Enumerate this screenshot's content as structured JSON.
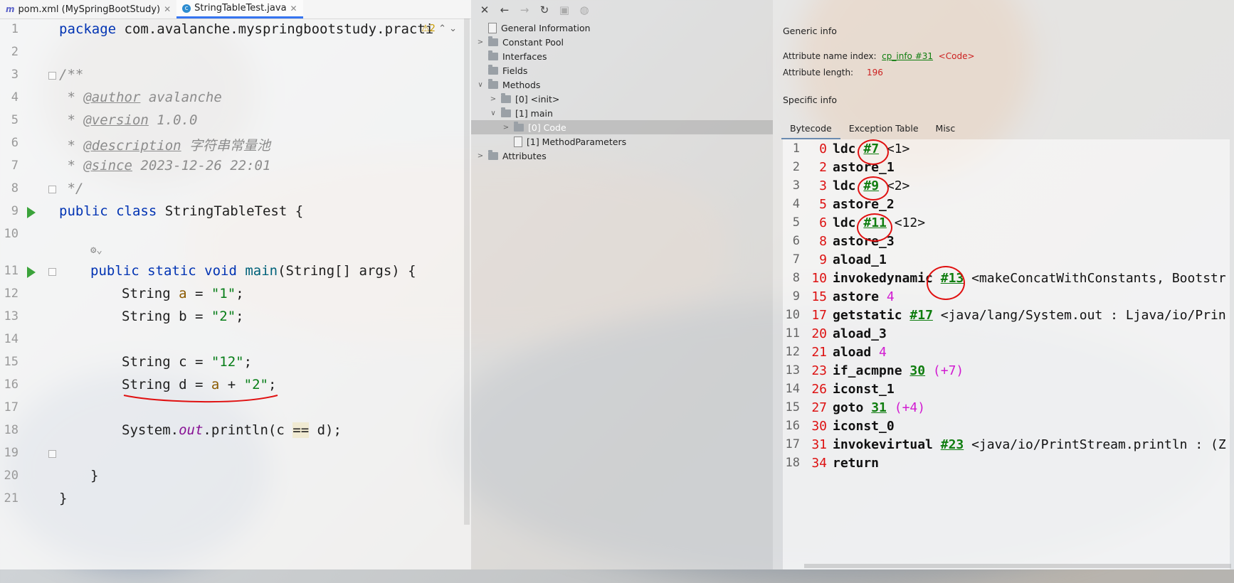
{
  "tabs": [
    {
      "icon": "m",
      "label": "pom.xml (MySpringBootStudy)"
    },
    {
      "icon": "c",
      "label": "StringTableTest.java"
    }
  ],
  "editor": {
    "line_numbers": [
      "1",
      "2",
      "3",
      "4",
      "5",
      "6",
      "7",
      "8",
      "9",
      "10",
      "11",
      "12",
      "13",
      "14",
      "15",
      "16",
      "17",
      "18",
      "19",
      "20",
      "21"
    ],
    "warning_count": "2",
    "code": {
      "l1_kw": "package",
      "l1_rest": " com.avalanche.myspringbootstudy.practi",
      "l3": "/**",
      "l4_pre": " * ",
      "l4_tag": "@author",
      "l4_val": " avalanche",
      "l5_pre": " * ",
      "l5_tag": "@version",
      "l5_val": " 1.0.0",
      "l6_pre": " * ",
      "l6_tag": "@description",
      "l6_val": " 字符串常量池",
      "l7_pre": " * ",
      "l7_tag": "@since",
      "l7_val": " 2023-12-26 22:01",
      "l8": " */",
      "l9_kw": "public class",
      "l9_rest": " StringTableTest {",
      "l11_kw": "public static void",
      "l11_fn": " main",
      "l11_rest": "(String[] args) {",
      "l12_a": "String ",
      "l12_v": "a",
      "l12_b": " = ",
      "l12_s": "\"1\"",
      "l12_c": ";",
      "l13_a": "String b = ",
      "l13_s": "\"2\"",
      "l13_c": ";",
      "l15_a": "String c = ",
      "l15_s": "\"12\"",
      "l15_c": ";",
      "l16_a": "String d = ",
      "l16_v": "a",
      "l16_b": " + ",
      "l16_s": "\"2\"",
      "l16_c": ";",
      "l18_a": "System.",
      "l18_f": "out",
      "l18_b": ".println(c ",
      "l18_op": "==",
      "l18_c": " d);",
      "l19": "}",
      "l20": "}"
    }
  },
  "tree": {
    "toolbar": [
      "close-icon",
      "back-icon",
      "forward-icon",
      "refresh-icon",
      "save-icon",
      "globe-icon"
    ],
    "nodes": [
      {
        "label": "General Information"
      },
      {
        "label": "Constant Pool"
      },
      {
        "label": "Interfaces"
      },
      {
        "label": "Fields"
      },
      {
        "label": "Methods"
      },
      {
        "label": "[0] <init>"
      },
      {
        "label": "[1] main"
      },
      {
        "label": "[0] Code"
      },
      {
        "label": "[1] MethodParameters"
      },
      {
        "label": "Attributes"
      }
    ]
  },
  "info": {
    "generic_title": "Generic info",
    "attr_name_label": "Attribute name index:",
    "attr_name_link": "cp_info #31",
    "attr_name_value": "<Code>",
    "attr_len_label": "Attribute length:",
    "attr_len_value": "196",
    "specific_title": "Specific info",
    "tabs": [
      "Bytecode",
      "Exception Table",
      "Misc"
    ],
    "bytecode": [
      {
        "n": "1",
        "off": "0",
        "op": "ldc",
        "ref": "#7",
        "c": " <1>"
      },
      {
        "n": "2",
        "off": "2",
        "op": "astore_1"
      },
      {
        "n": "3",
        "off": "3",
        "op": "ldc",
        "ref": "#9",
        "c": " <2>"
      },
      {
        "n": "4",
        "off": "5",
        "op": "astore_2"
      },
      {
        "n": "5",
        "off": "6",
        "op": "ldc",
        "ref": "#11",
        "c": " <12>"
      },
      {
        "n": "6",
        "off": "8",
        "op": "astore_3"
      },
      {
        "n": "7",
        "off": "9",
        "op": "aload_1"
      },
      {
        "n": "8",
        "off": "10",
        "op": "invokedynamic",
        "ref": "#13",
        "c": " <makeConcatWithConstants, Bootstr"
      },
      {
        "n": "9",
        "off": "15",
        "op": "astore",
        "num": "4"
      },
      {
        "n": "10",
        "off": "17",
        "op": "getstatic",
        "ref": "#17",
        "c": " <java/lang/System.out : Ljava/io/Prin"
      },
      {
        "n": "11",
        "off": "20",
        "op": "aload_3"
      },
      {
        "n": "12",
        "off": "21",
        "op": "aload",
        "num": "4"
      },
      {
        "n": "13",
        "off": "23",
        "op": "if_acmpne",
        "ref": "30",
        "num": "(+7)"
      },
      {
        "n": "14",
        "off": "26",
        "op": "iconst_1"
      },
      {
        "n": "15",
        "off": "27",
        "op": "goto",
        "ref": "31",
        "num": "(+4)"
      },
      {
        "n": "16",
        "off": "30",
        "op": "iconst_0"
      },
      {
        "n": "17",
        "off": "31",
        "op": "invokevirtual",
        "ref": "#23",
        "c": " <java/io/PrintStream.println : (Z"
      },
      {
        "n": "18",
        "off": "34",
        "op": "return"
      }
    ]
  }
}
